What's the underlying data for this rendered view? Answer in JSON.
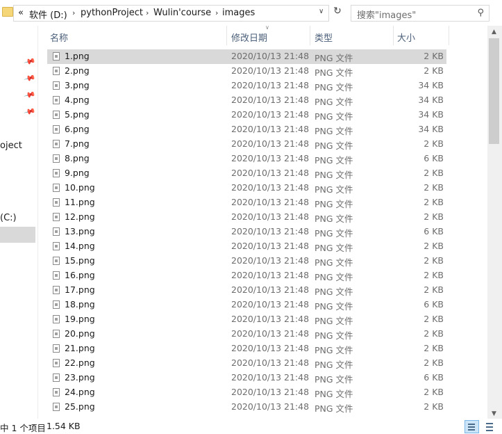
{
  "address": {
    "overflow": "«",
    "crumbs": [
      "软件 (D:)",
      "pythonProject",
      "Wulin'course",
      "images"
    ],
    "search_placeholder": "搜索\"images\""
  },
  "nav": {
    "partial_item": "oject",
    "drive_item": "(C:)"
  },
  "columns": {
    "name": "名称",
    "date": "修改日期",
    "type": "类型",
    "size": "大小"
  },
  "files": [
    {
      "name": "1.png",
      "date": "2020/10/13 21:48",
      "type": "PNG 文件",
      "size": "2 KB"
    },
    {
      "name": "2.png",
      "date": "2020/10/13 21:48",
      "type": "PNG 文件",
      "size": "2 KB"
    },
    {
      "name": "3.png",
      "date": "2020/10/13 21:48",
      "type": "PNG 文件",
      "size": "34 KB"
    },
    {
      "name": "4.png",
      "date": "2020/10/13 21:48",
      "type": "PNG 文件",
      "size": "34 KB"
    },
    {
      "name": "5.png",
      "date": "2020/10/13 21:48",
      "type": "PNG 文件",
      "size": "34 KB"
    },
    {
      "name": "6.png",
      "date": "2020/10/13 21:48",
      "type": "PNG 文件",
      "size": "34 KB"
    },
    {
      "name": "7.png",
      "date": "2020/10/13 21:48",
      "type": "PNG 文件",
      "size": "2 KB"
    },
    {
      "name": "8.png",
      "date": "2020/10/13 21:48",
      "type": "PNG 文件",
      "size": "6 KB"
    },
    {
      "name": "9.png",
      "date": "2020/10/13 21:48",
      "type": "PNG 文件",
      "size": "2 KB"
    },
    {
      "name": "10.png",
      "date": "2020/10/13 21:48",
      "type": "PNG 文件",
      "size": "2 KB"
    },
    {
      "name": "11.png",
      "date": "2020/10/13 21:48",
      "type": "PNG 文件",
      "size": "2 KB"
    },
    {
      "name": "12.png",
      "date": "2020/10/13 21:48",
      "type": "PNG 文件",
      "size": "2 KB"
    },
    {
      "name": "13.png",
      "date": "2020/10/13 21:48",
      "type": "PNG 文件",
      "size": "6 KB"
    },
    {
      "name": "14.png",
      "date": "2020/10/13 21:48",
      "type": "PNG 文件",
      "size": "2 KB"
    },
    {
      "name": "15.png",
      "date": "2020/10/13 21:48",
      "type": "PNG 文件",
      "size": "2 KB"
    },
    {
      "name": "16.png",
      "date": "2020/10/13 21:48",
      "type": "PNG 文件",
      "size": "2 KB"
    },
    {
      "name": "17.png",
      "date": "2020/10/13 21:48",
      "type": "PNG 文件",
      "size": "2 KB"
    },
    {
      "name": "18.png",
      "date": "2020/10/13 21:48",
      "type": "PNG 文件",
      "size": "6 KB"
    },
    {
      "name": "19.png",
      "date": "2020/10/13 21:48",
      "type": "PNG 文件",
      "size": "2 KB"
    },
    {
      "name": "20.png",
      "date": "2020/10/13 21:48",
      "type": "PNG 文件",
      "size": "2 KB"
    },
    {
      "name": "21.png",
      "date": "2020/10/13 21:48",
      "type": "PNG 文件",
      "size": "2 KB"
    },
    {
      "name": "22.png",
      "date": "2020/10/13 21:48",
      "type": "PNG 文件",
      "size": "2 KB"
    },
    {
      "name": "23.png",
      "date": "2020/10/13 21:48",
      "type": "PNG 文件",
      "size": "6 KB"
    },
    {
      "name": "24.png",
      "date": "2020/10/13 21:48",
      "type": "PNG 文件",
      "size": "2 KB"
    },
    {
      "name": "25.png",
      "date": "2020/10/13 21:48",
      "type": "PNG 文件",
      "size": "2 KB"
    }
  ],
  "selected_index": 0,
  "status": {
    "selection": "中 1 个项目",
    "selection_size": "1.54 KB"
  },
  "colors": {
    "selected_row": "#d9d9d9",
    "header_text": "#4c607a",
    "folder": "#f5d779"
  }
}
